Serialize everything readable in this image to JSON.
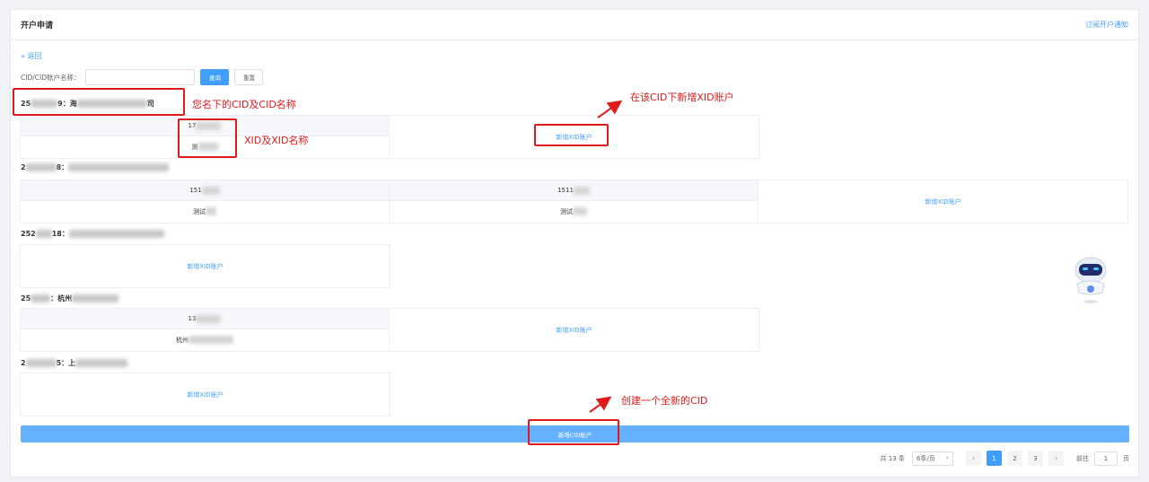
{
  "panel": {
    "title": "开户申请",
    "subscribe_link": "订阅开户通知"
  },
  "back_link": "« 返回",
  "search": {
    "label": "CID/CID账户名称：",
    "value": "",
    "placeholder": "",
    "query_button": "查询",
    "reset_button": "重置"
  },
  "cid_groups": [
    {
      "header_prefix": "25",
      "header_tail": "9：海",
      "header_end": "司",
      "xids": [
        {
          "id": "17",
          "name": "测"
        }
      ],
      "add_xid_label": "新增XID账户"
    },
    {
      "header_prefix": "2",
      "header_tail": "8：",
      "header_end": "",
      "xids": [
        {
          "id": "151",
          "name": "测试"
        },
        {
          "id": "1511",
          "name": "测试"
        }
      ],
      "add_xid_label": "新增XID账户"
    },
    {
      "header_prefix": "252",
      "header_tail": "18：",
      "header_end": "",
      "xids": [],
      "add_xid_label": "新增XID账户"
    },
    {
      "header_prefix": "25",
      "header_tail": "：杭州",
      "header_end": "",
      "xids": [
        {
          "id": "13",
          "name": "杭州"
        }
      ],
      "add_xid_label": "新增XID账户"
    },
    {
      "header_prefix": "2",
      "header_tail": "5：上",
      "header_end": "",
      "xids": [],
      "add_xid_label": "新增XID账户"
    }
  ],
  "add_cid_button": "新增CID账户",
  "pagination": {
    "total": "共 13 条",
    "page_size": "6条/页",
    "pages": [
      "1",
      "2",
      "3"
    ],
    "current_page": "1",
    "goto_label": "前往",
    "goto_value": "1",
    "goto_suffix": "页",
    "prev_icon": "‹",
    "next_icon": "›"
  },
  "annotations": {
    "cid_note": "您名下的CID及CID名称",
    "xid_note": "XID及XID名称",
    "add_xid_note": "在该CID下新增XID账户",
    "add_cid_note": "创建一个全新的CID"
  },
  "colors": {
    "accent": "#409eff",
    "annotation": "#e01a1a",
    "add_cid_bar": "#66b1ff"
  }
}
